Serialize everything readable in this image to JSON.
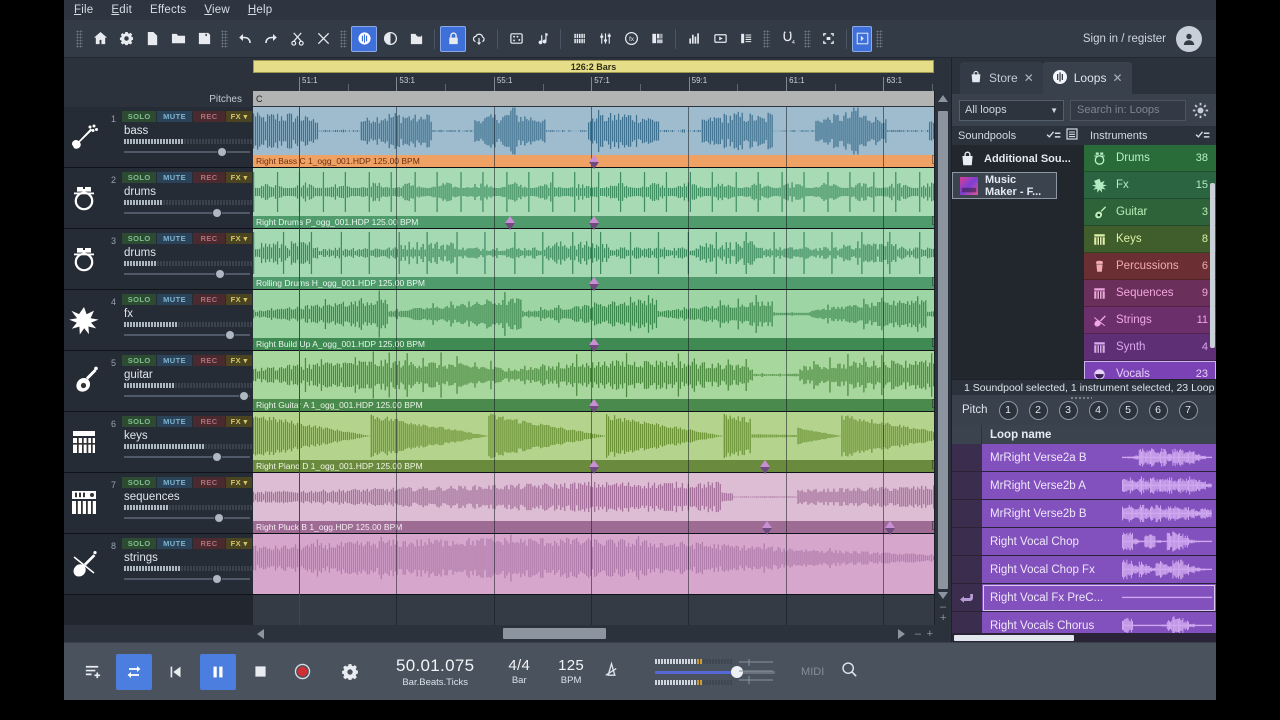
{
  "menu": {
    "items": [
      "File",
      "Edit",
      "Effects",
      "View",
      "Help"
    ]
  },
  "toolbar": {
    "icons": [
      "home-icon",
      "settings-gear-icon",
      "new-document-icon",
      "open-folder-icon",
      "save-disk-icon",
      "undo-icon",
      "redo-icon",
      "cut-scissors-icon",
      "delete-x-icon",
      "audio-waveform-icon",
      "record-dial-icon",
      "folder-open-icon",
      "lock-icon",
      "cloud-download-icon",
      "grid-pads-icon",
      "music-note-icon",
      "piano-keys-icon",
      "mixer-faders-icon",
      "fx-circle-icon",
      "color-palette-icon",
      "bar-levels-icon",
      "video-play-icon",
      "score-editor-icon",
      "tuning-icon",
      "fullscreen-icon",
      "expand-arrow-icon"
    ],
    "sign_in_label": "Sign in / register",
    "avatar_icon": "user-avatar-icon",
    "accent_color": "#3f6fd8"
  },
  "arranger": {
    "loop_bar_label": "126:2 Bars",
    "pitches_label": "Pitches",
    "key_label": "C",
    "ruler_labels": [
      "51:1",
      "53:1",
      "55:1",
      "57:1",
      "59:1",
      "61:1",
      "63:1"
    ],
    "track_button_labels": {
      "solo": "SOLO",
      "mute": "MUTE",
      "rec": "REC",
      "fx": "FX"
    },
    "tracks": [
      {
        "number": "1",
        "name": "bass",
        "icon": "bass-guitar-icon",
        "volume_pct": 78,
        "meter_pct": 46,
        "clip_label": "Right Bass C 1_ogg_001.HDP  125.00 BPM",
        "clip_color": "#9fbcce",
        "wave_color": "#3f7291",
        "label_bg": "#f0a265",
        "label_color": "#6b2f10"
      },
      {
        "number": "2",
        "name": "drums",
        "icon": "drum-kit-icon",
        "volume_pct": 74,
        "meter_pct": 30,
        "clip_label": "Right Drums P_ogg_001.HDP  125.00 BPM",
        "clip_color": "#a8dbb4",
        "wave_color": "#3f8f62",
        "label_bg": "#4f9b6c",
        "label_color": "#eaf6ee"
      },
      {
        "number": "3",
        "name": "drums",
        "icon": "drum-kit-icon",
        "volume_pct": 76,
        "meter_pct": 26,
        "clip_label": "Rolling Drums H_ogg_001.HDP  125.00 BPM",
        "clip_color": "#a5d9b3",
        "wave_color": "#3d8c60",
        "label_bg": "#4f9b6c",
        "label_color": "#eaf6ee"
      },
      {
        "number": "4",
        "name": "fx",
        "icon": "fx-burst-icon",
        "volume_pct": 84,
        "meter_pct": 42,
        "clip_label": "Right Build Up A_ogg_001.HDP  125.00 BPM",
        "clip_color": "#9ed5a5",
        "wave_color": "#3d8a4f",
        "label_bg": "#3f8a52",
        "label_color": "#e7f5ea"
      },
      {
        "number": "5",
        "name": "guitar",
        "icon": "acoustic-guitar-icon",
        "volume_pct": 95,
        "meter_pct": 40,
        "clip_label": "Right Guitar A 1_ogg_001.HDP  125.00 BPM",
        "clip_color": "#a7d79c",
        "wave_color": "#4b8a3f",
        "label_bg": "#4b8a4d",
        "label_color": "#eaf6e6"
      },
      {
        "number": "6",
        "name": "keys",
        "icon": "piano-icon",
        "volume_pct": 74,
        "meter_pct": 62,
        "clip_label": "Right Piano D 1_ogg_001.HDP  125.00 BPM",
        "clip_color": "#b4d48d",
        "wave_color": "#6c9436",
        "label_bg": "#6a8a3e",
        "label_color": "#f1f6e4"
      },
      {
        "number": "7",
        "name": "sequences",
        "icon": "synth-keyboard-icon",
        "volume_pct": 75,
        "meter_pct": 34,
        "clip_label": "Right Pluck B 1_ogg.HDP  125.00 BPM",
        "clip_color": "#dcbdd3",
        "wave_color": "#a4709b",
        "label_bg": "#9d6b93",
        "label_color": "#f8eef5"
      },
      {
        "number": "8",
        "name": "strings",
        "icon": "violin-icon",
        "volume_pct": 74,
        "meter_pct": 44,
        "clip_label": "",
        "clip_color": "#d7a6cd",
        "wave_color": "#b07cab",
        "label_bg": "#a56ea0",
        "label_color": "#f8eef5"
      }
    ]
  },
  "media": {
    "tabs": [
      {
        "label": "Store",
        "icon": "shopping-bag-icon",
        "active": false,
        "close_icon": "close-x-icon"
      },
      {
        "label": "Loops",
        "icon": "loops-waveform-icon",
        "active": true,
        "close_icon": "close-x-icon"
      }
    ],
    "filter_select_value": "All loops",
    "search_placeholder": "Search in: Loops",
    "settings_icon": "settings-sun-icon",
    "soundpools_header": "Soundpools",
    "instruments_header": "Instruments",
    "soundpools": [
      {
        "label": "Additional Sou...",
        "icon": "lock-bag-icon",
        "selected": false
      },
      {
        "label": "Music Maker - F...",
        "icon": "album-thumbnail-icon",
        "selected": true
      }
    ],
    "instruments": [
      {
        "label": "Drums",
        "count": "38",
        "icon": "drum-kit-icon",
        "bg": "#2a6b3a",
        "fg": "#b9f0c6",
        "selected": false
      },
      {
        "label": "Fx",
        "count": "15",
        "icon": "fx-burst-icon",
        "bg": "#2a6440",
        "fg": "#b4ebc2",
        "selected": false
      },
      {
        "label": "Guitar",
        "count": "3",
        "icon": "guitar-icon",
        "bg": "#2e6238",
        "fg": "#b9eeb8",
        "selected": false
      },
      {
        "label": "Keys",
        "count": "8",
        "icon": "piano-icon",
        "bg": "#3f5e2c",
        "fg": "#dff0a8",
        "selected": false
      },
      {
        "label": "Percussions",
        "count": "6",
        "icon": "conga-drum-icon",
        "bg": "#6b2f33",
        "fg": "#f0aab0",
        "selected": false
      },
      {
        "label": "Sequences",
        "count": "9",
        "icon": "synth-keyboard-icon",
        "bg": "#6b2f5c",
        "fg": "#f0a6dd",
        "selected": false
      },
      {
        "label": "Strings",
        "count": "11",
        "icon": "violin-icon",
        "bg": "#6b2f6b",
        "fg": "#f0a6e8",
        "selected": false
      },
      {
        "label": "Synth",
        "count": "4",
        "icon": "synth-keyboard-icon",
        "bg": "#5e2f74",
        "fg": "#dca6f0",
        "selected": false
      },
      {
        "label": "Vocals",
        "count": "23",
        "icon": "vocals-mouth-icon",
        "bg": "#7a42b5",
        "fg": "#e6d0f8",
        "selected": true
      }
    ],
    "status_text": "1 Soundpool selected, 1 instrument selected, 23 Loop",
    "pitch_label": "Pitch",
    "pitch_buttons": [
      "1",
      "2",
      "3",
      "4",
      "5",
      "6",
      "7"
    ],
    "loops_column_header": "Loop name",
    "loops": [
      {
        "name": "MrRight Verse2a B",
        "selected": false,
        "has_preview_icon": false
      },
      {
        "name": "MrRight Verse2b A",
        "selected": false,
        "has_preview_icon": false
      },
      {
        "name": "MrRight Verse2b B",
        "selected": false,
        "has_preview_icon": false
      },
      {
        "name": "Right Vocal Chop",
        "selected": false,
        "has_preview_icon": false
      },
      {
        "name": "Right Vocal Chop Fx",
        "selected": false,
        "has_preview_icon": false
      },
      {
        "name": "Right Vocal Fx PreC...",
        "selected": true,
        "has_preview_icon": true
      },
      {
        "name": "Right Vocals Chorus",
        "selected": false,
        "has_preview_icon": false
      }
    ]
  },
  "transport": {
    "buttons": [
      {
        "name": "add-track-icon",
        "state": "normal"
      },
      {
        "name": "loop-toggle-icon",
        "state": "active"
      },
      {
        "name": "rewind-start-icon",
        "state": "normal"
      },
      {
        "name": "pause-icon",
        "state": "active"
      },
      {
        "name": "stop-icon",
        "state": "normal"
      },
      {
        "name": "record-icon",
        "state": "normal"
      },
      {
        "name": "settings-gear-icon",
        "state": "normal"
      }
    ],
    "position_value": "50.01.075",
    "position_label": "Bar.Beats.Ticks",
    "timesig_value": "4/4",
    "timesig_label": "Bar",
    "tempo_value": "125",
    "tempo_label": "BPM",
    "metronome_icon": "metronome-icon",
    "master_volume_pct": 63,
    "midi_label": "MIDI",
    "search_icon": "magnifier-icon"
  },
  "colors": {
    "window_bg": "#2b323c",
    "toolbar_bg": "#333b46",
    "accent_blue": "#4c7ee0",
    "loop_bar_yellow": "#e6dd88",
    "playhead_red": "#e0303a",
    "vocals_purple": "#8251bd"
  }
}
